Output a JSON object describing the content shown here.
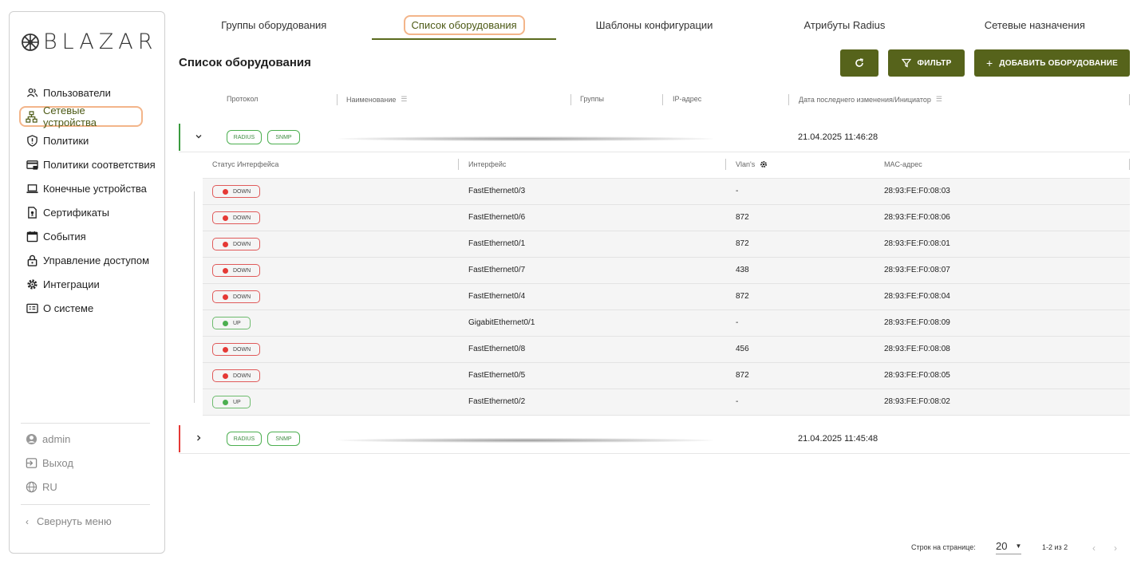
{
  "brand": {
    "logo_text": "BLAZAR"
  },
  "sidebar": {
    "items": [
      {
        "label": "Пользователи",
        "icon": "users-icon"
      },
      {
        "label": "Сетевые устройства",
        "icon": "network-icon"
      },
      {
        "label": "Политики",
        "icon": "info-shield-icon"
      },
      {
        "label": "Политики соответствия",
        "icon": "card-icon"
      },
      {
        "label": "Конечные устройства",
        "icon": "laptop-icon"
      },
      {
        "label": "Сертификаты",
        "icon": "certificate-icon"
      },
      {
        "label": "События",
        "icon": "calendar-icon"
      },
      {
        "label": "Управление доступом",
        "icon": "lock-icon"
      },
      {
        "label": "Интеграции",
        "icon": "gear-icon"
      },
      {
        "label": "О системе",
        "icon": "about-icon"
      }
    ],
    "active_index": 1,
    "user": "admin",
    "logout": "Выход",
    "language": "RU",
    "collapse": "Свернуть меню"
  },
  "tabs": [
    {
      "label": "Группы оборудования"
    },
    {
      "label": "Список оборудования"
    },
    {
      "label": "Шаблоны конфигурации"
    },
    {
      "label": "Атрибуты Radius"
    },
    {
      "label": "Сетевые назначения"
    }
  ],
  "page": {
    "title": "Список оборудования",
    "filter_label": "ФИЛЬТР",
    "add_label": "ДОБАВИТЬ ОБОРУДОВАНИЕ"
  },
  "table": {
    "headers": {
      "protocol": "Протокол",
      "name": "Наименование",
      "groups": "Группы",
      "ip": "IP-адрес",
      "changed": "Дата последнего изменения/Инициатор"
    },
    "devices": [
      {
        "tags": [
          "RADIUS",
          "SNMP"
        ],
        "date": "21.04.2025 11:46:28",
        "expanded": true,
        "status_color": "#3a9a3e"
      },
      {
        "tags": [
          "RADIUS",
          "SNMP"
        ],
        "date": "21.04.2025 11:45:48",
        "expanded": false,
        "status_color": "#e53935"
      }
    ]
  },
  "interfaces": {
    "headers": {
      "status": "Статус Интерфейса",
      "interface": "Интерфейс",
      "vlans": "Vlan's",
      "mac": "MAC-адрес"
    },
    "rows": [
      {
        "status": "DOWN",
        "interface": "FastEthernet0/3",
        "vlan": "-",
        "mac": "28:93:FE:F0:08:03"
      },
      {
        "status": "DOWN",
        "interface": "FastEthernet0/6",
        "vlan": "872",
        "mac": "28:93:FE:F0:08:06"
      },
      {
        "status": "DOWN",
        "interface": "FastEthernet0/1",
        "vlan": "872",
        "mac": "28:93:FE:F0:08:01"
      },
      {
        "status": "DOWN",
        "interface": "FastEthernet0/7",
        "vlan": "438",
        "mac": "28:93:FE:F0:08:07"
      },
      {
        "status": "DOWN",
        "interface": "FastEthernet0/4",
        "vlan": "872",
        "mac": "28:93:FE:F0:08:04"
      },
      {
        "status": "UP",
        "interface": "GigabitEthernet0/1",
        "vlan": "-",
        "mac": "28:93:FE:F0:08:09"
      },
      {
        "status": "DOWN",
        "interface": "FastEthernet0/8",
        "vlan": "456",
        "mac": "28:93:FE:F0:08:08"
      },
      {
        "status": "DOWN",
        "interface": "FastEthernet0/5",
        "vlan": "872",
        "mac": "28:93:FE:F0:08:05"
      },
      {
        "status": "UP",
        "interface": "FastEthernet0/2",
        "vlan": "-",
        "mac": "28:93:FE:F0:08:02"
      }
    ]
  },
  "pagination": {
    "rows_label": "Строк на странице:",
    "rows_value": "20",
    "range": "1-2 из 2"
  },
  "colors": {
    "accent": "#56631b",
    "highlight": "#f3b58a",
    "down": "#e53935",
    "up": "#4caf50"
  }
}
